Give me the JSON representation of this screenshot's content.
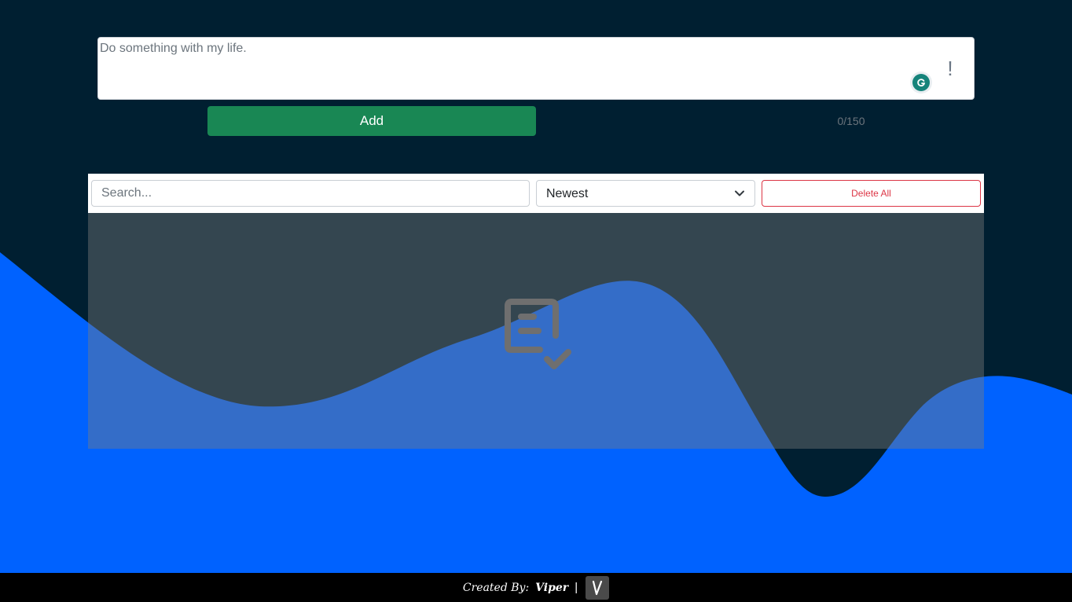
{
  "note_input": {
    "value": "Do something with my life.",
    "alert_glyph": "!",
    "icons": [
      "grammarly-icon",
      "alert-icon"
    ]
  },
  "add_button": {
    "label": "Add",
    "color": "#198754"
  },
  "char_counter": "0/150",
  "toolbar": {
    "search_placeholder": "Search...",
    "sort_selected": "Newest",
    "delete_all_label": "Delete All",
    "delete_color": "#dc3545"
  },
  "empty_state": {
    "icon": "clipboard-check-icon"
  },
  "footer": {
    "created_by_label": "Created By:",
    "author": "Viper",
    "separator": "|",
    "logo_letter": "V"
  },
  "colors": {
    "background": "#001f31",
    "wave": "#0062ff",
    "footer": "#000000"
  }
}
